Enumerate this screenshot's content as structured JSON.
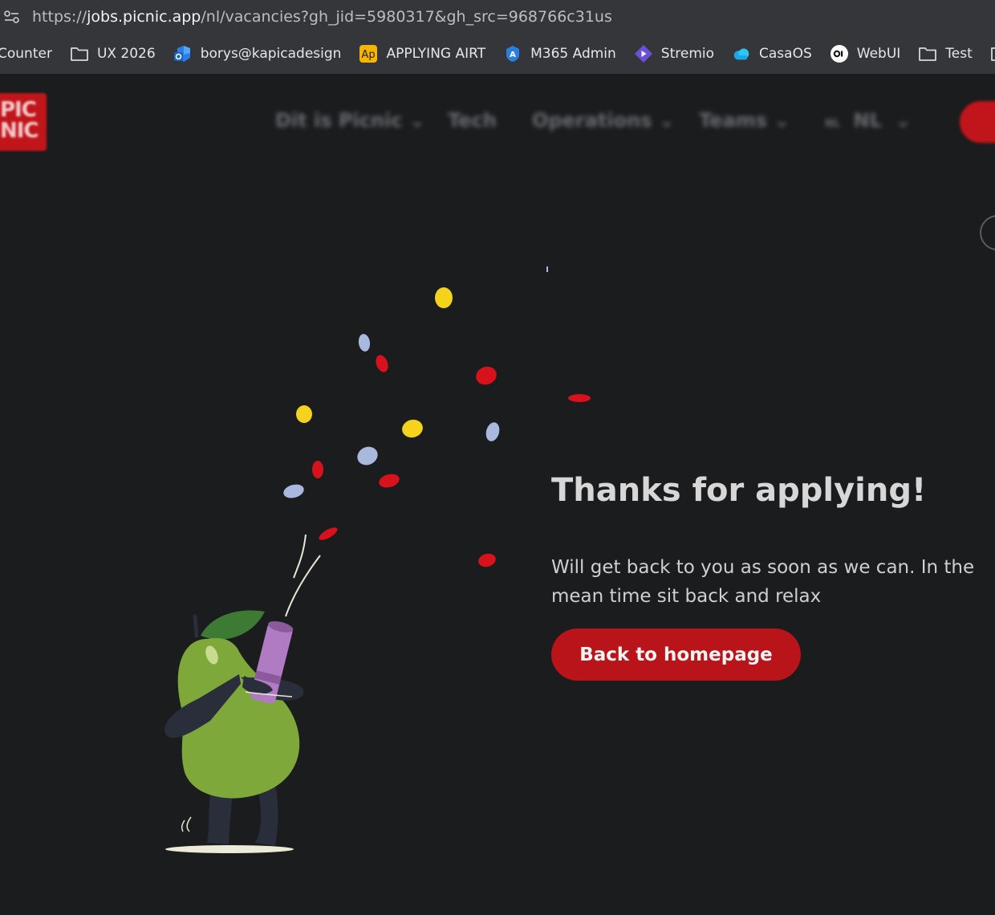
{
  "browser": {
    "url_prefix": "https://",
    "url_host": "jobs.picnic.app",
    "url_path": "/nl/vacancies?gh_jid=5980317&gh_src=968766c31us",
    "bookmarks": [
      {
        "label": "Counter",
        "icon": "none"
      },
      {
        "label": "UX 2026",
        "icon": "folder-icon"
      },
      {
        "label": "borys@kapicadesign",
        "icon": "outlook-icon"
      },
      {
        "label": "APPLYING AIRT",
        "icon": "ap-icon"
      },
      {
        "label": "M365 Admin",
        "icon": "admin-icon"
      },
      {
        "label": "Stremio",
        "icon": "stremio-icon"
      },
      {
        "label": "CasaOS",
        "icon": "cloud-icon"
      },
      {
        "label": "WebUI",
        "icon": "openwebui-icon"
      },
      {
        "label": "Test",
        "icon": "folder-icon"
      },
      {
        "label": "",
        "icon": "folder-icon"
      }
    ]
  },
  "nav": {
    "logo_text_1": "PIC",
    "logo_text_2": "NIC",
    "links": [
      {
        "label": "Dit is Picnic",
        "chevron": true
      },
      {
        "label": "Tech",
        "chevron": false
      },
      {
        "label": "Operations",
        "chevron": true
      },
      {
        "label": "Teams",
        "chevron": true
      }
    ],
    "language_flag": "NL",
    "language": "NL"
  },
  "content": {
    "heading": "Thanks for applying!",
    "message": "Will get back to you as soon as we can. In the mean time sit back and relax",
    "button_label": "Back to homepage"
  },
  "colors": {
    "background": "#1b1c1e",
    "accent_red": "#b8141a",
    "confetti_yellow": "#f5d21c",
    "confetti_red": "#d8121c",
    "confetti_blue": "#a8b9dd",
    "pear_green": "#7fa83a"
  }
}
